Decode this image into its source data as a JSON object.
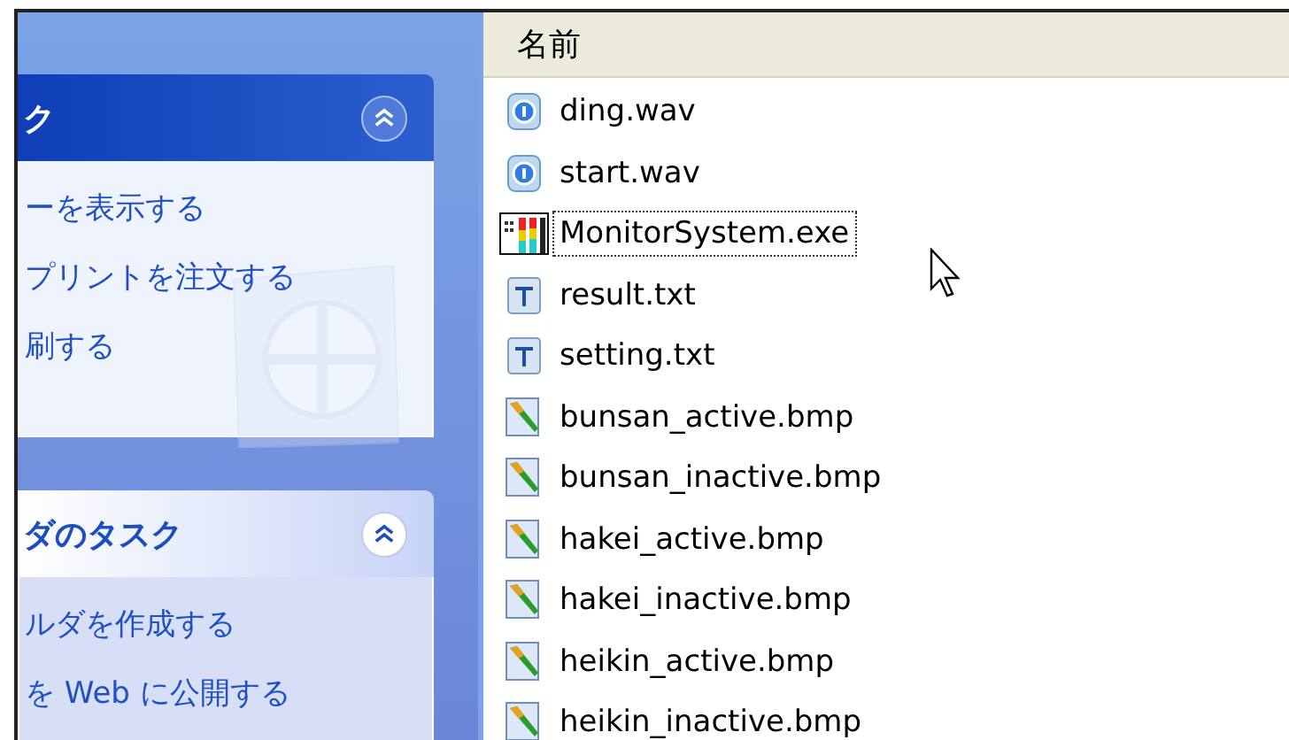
{
  "task_panes": [
    {
      "title": "ク",
      "kind": "special",
      "expanded": true,
      "links": [
        "ーを表示する",
        "プリントを注文する",
        "刷する"
      ]
    },
    {
      "title": "ダのタスク",
      "kind": "normal",
      "expanded": true,
      "links": [
        "ルダを作成する",
        "を Web に公開する"
      ]
    }
  ],
  "file_list": {
    "columns": [
      {
        "label": "名前"
      }
    ],
    "files": [
      {
        "name": "ding.wav",
        "kind": "sound",
        "focused": false
      },
      {
        "name": "start.wav",
        "kind": "sound",
        "focused": false
      },
      {
        "name": "MonitorSystem.exe",
        "kind": "program",
        "focused": true
      },
      {
        "name": "result.txt",
        "kind": "text",
        "focused": false
      },
      {
        "name": "setting.txt",
        "kind": "text",
        "focused": false
      },
      {
        "name": "bunsan_active.bmp",
        "kind": "bitmap",
        "focused": false
      },
      {
        "name": "bunsan_inactive.bmp",
        "kind": "bitmap",
        "focused": false
      },
      {
        "name": "hakei_active.bmp",
        "kind": "bitmap",
        "focused": false
      },
      {
        "name": "hakei_inactive.bmp",
        "kind": "bitmap",
        "focused": false
      },
      {
        "name": "heikin_active.bmp",
        "kind": "bitmap",
        "focused": false
      },
      {
        "name": "heikin_inactive.bmp",
        "kind": "bitmap",
        "focused": false
      }
    ]
  }
}
